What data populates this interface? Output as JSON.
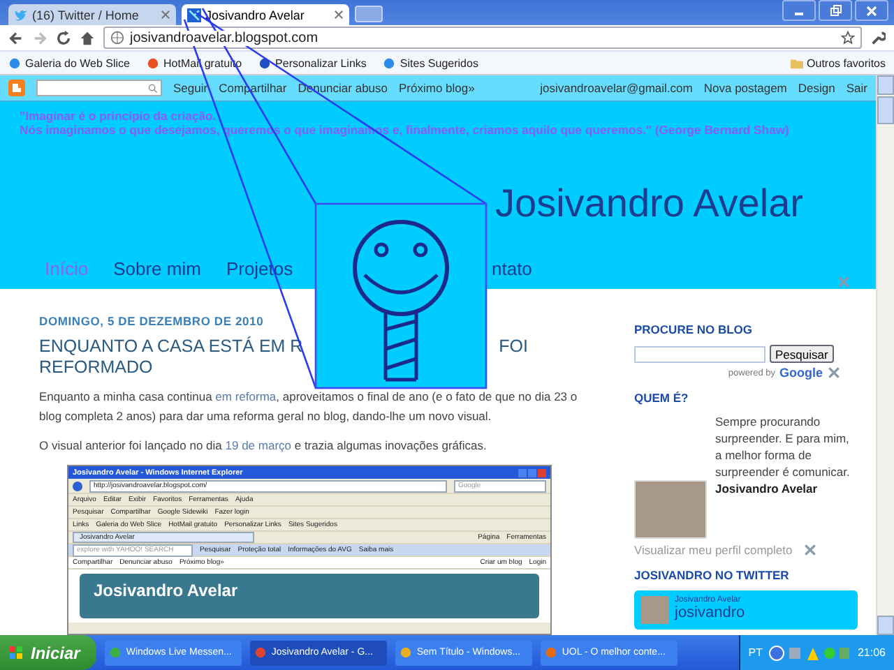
{
  "browser": {
    "tabs": [
      {
        "title": "(16) Twitter / Home",
        "selected": false,
        "kind": "twitter"
      },
      {
        "title": "Josivandro Avelar",
        "selected": true,
        "kind": "blog"
      }
    ],
    "url": "josivandroavelar.blogspot.com",
    "bookmarks": [
      "Galeria do Web Slice",
      "HotMail gratuito",
      "Personalizar Links",
      "Sites Sugeridos"
    ],
    "other_bookmarks": "Outros favoritos"
  },
  "navbar": {
    "left_links": [
      "Seguir",
      "Compartilhar",
      "Denunciar abuso",
      "Próximo blog»"
    ],
    "right_links": [
      "josivandroavelar@gmail.com",
      "Nova postagem",
      "Design",
      "Sair"
    ]
  },
  "header": {
    "quote_lines": [
      "\"Imaginar é o princípio da criação.",
      "Nós imaginamos o que desejamos, queremos o que imaginamos e, finalmente, criamos aquilo que queremos.\" (George Bernard Shaw)"
    ],
    "title": "Josivandro Avelar",
    "tabs": [
      {
        "label": "Início",
        "selected": true
      },
      {
        "label": "Sobre mim",
        "selected": false
      },
      {
        "label": "Projetos",
        "selected": false
      }
    ],
    "last_tab_visible": "ntato"
  },
  "post": {
    "date": "DOMINGO, 5 DE DEZEMBRO DE 2010",
    "title_start": "ENQUANTO A CASA ESTÁ EM R",
    "title_after": "FOI",
    "title_line2": "REFORMADO",
    "paragraphs": [
      [
        {
          "text": "Enquanto a minha casa continua ",
          "link": false
        },
        {
          "text": "em reforma",
          "link": true
        },
        {
          "text": ", aproveitamos o final de ano (e o fato de que no dia 23 o blog completa 2 anos) para dar uma reforma geral no blog, dando-lhe um novo visual.",
          "link": false
        }
      ],
      [
        {
          "text": "O visual anterior foi lançado no dia ",
          "link": false
        },
        {
          "text": "19 de março",
          "link": true
        },
        {
          "text": " e trazia algumas inovações gráficas.",
          "link": false
        }
      ]
    ],
    "screenshot": {
      "window_title": "Josivandro Avelar - Windows Internet Explorer",
      "address": "http://josivandroavelar.blogspot.com/",
      "search_placeholder": "Google",
      "menu": [
        "Arquivo",
        "Editar",
        "Exibir",
        "Favoritos",
        "Ferramentas",
        "Ajuda"
      ],
      "google_toolbar": [
        "Pesquisar",
        "Compartilhar",
        "Google Sidewiki",
        "Fazer login"
      ],
      "links_label": "Links",
      "links": [
        "Galeria do Web Slice",
        "HotMail gratuito",
        "Personalizar Links",
        "Sites Sugeridos"
      ],
      "tab": "Josivandro Avelar",
      "command_bar": [
        "Página",
        "Ferramentas"
      ],
      "avg_search_placeholder": "explore with YAHOO! SEARCH",
      "avg_toolbar": [
        "Pesquisar",
        "Proteção total",
        "Informações do AVG",
        "Saiba mais"
      ],
      "navbar_links": [
        "Compartilhar",
        "Denunciar abuso",
        "Próximo blog»"
      ],
      "navbar_right": [
        "Criar um blog",
        "Login"
      ],
      "blog_title": "Josivandro Avelar"
    }
  },
  "sidebar": {
    "search_heading": "PROCURE NO BLOG",
    "search_button": "Pesquisar",
    "powered_by": "powered by",
    "powered_logo": "Google",
    "profile_heading": "QUEM É?",
    "profile_name": "Josivandro Avelar",
    "profile_bio": "Sempre procurando surpreender. E para mim, a melhor forma de surpreender é comunicar.",
    "profile_link": "Visualizar meu perfil completo",
    "twitter_heading": "JOSIVANDRO NO TWITTER",
    "twitter_name": "Josivandro Avelar",
    "twitter_handle": "josivandro"
  },
  "taskbar": {
    "start": "Iniciar",
    "tasks": [
      {
        "label": "Windows Live Messen...",
        "selected": false,
        "kind": "messenger"
      },
      {
        "label": "Josivandro Avelar - G...",
        "selected": true,
        "kind": "chrome"
      },
      {
        "label": "Sem Título - Windows...",
        "selected": false,
        "kind": "paint"
      },
      {
        "label": "UOL - O melhor conte...",
        "selected": false,
        "kind": "firefox"
      }
    ],
    "language": "PT",
    "clock": "21:06"
  }
}
